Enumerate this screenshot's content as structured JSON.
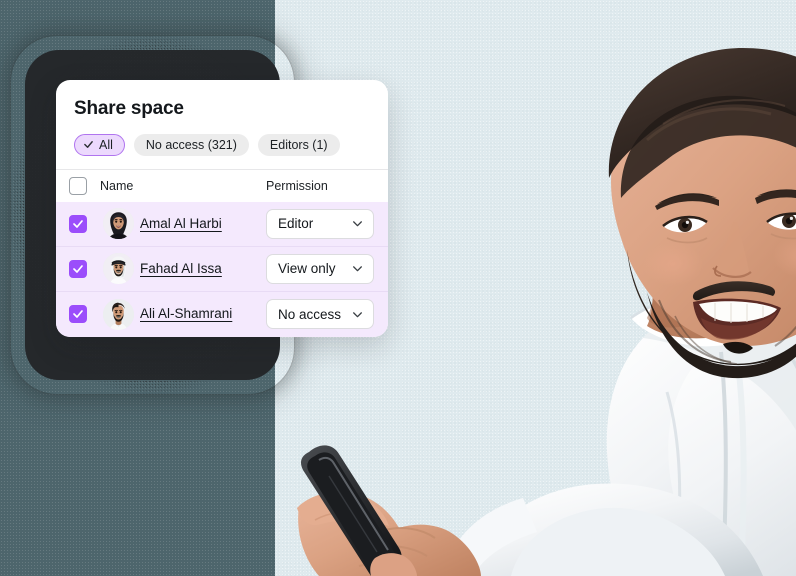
{
  "theme": {
    "accent_purple": "#9b4dfb",
    "chip_active_bg": "#ecd9fd",
    "chip_active_border": "#b074ef",
    "row_bg": "#f4e9fd",
    "card_bg": "#ffffff",
    "panel_dark": "#4d656c",
    "panel_light": "#dfeaee",
    "plate_dark": "#25282b"
  },
  "card": {
    "title": "Share space",
    "filters": [
      {
        "label": "All",
        "active": true,
        "icon": "check-icon"
      },
      {
        "label": "No access (321)",
        "active": false
      },
      {
        "label": "Editors (1)",
        "active": false
      }
    ],
    "table": {
      "columns": {
        "select_all": "",
        "name": "Name",
        "permission": "Permission"
      },
      "select_all_checked": false,
      "rows": [
        {
          "name": "Amal Al Harbi",
          "permission": "Editor",
          "checked": true,
          "avatar": "avatar-amal"
        },
        {
          "name": "Fahad Al Issa",
          "permission": "View only",
          "checked": true,
          "avatar": "avatar-fahad"
        },
        {
          "name": "Ali Al-Shamrani",
          "permission": "No access",
          "checked": true,
          "avatar": "avatar-ali"
        }
      ],
      "permission_options": [
        "Editor",
        "View only",
        "No access"
      ]
    }
  },
  "photo": {
    "alt": "Smiling man in white thobe holding a smartphone"
  }
}
